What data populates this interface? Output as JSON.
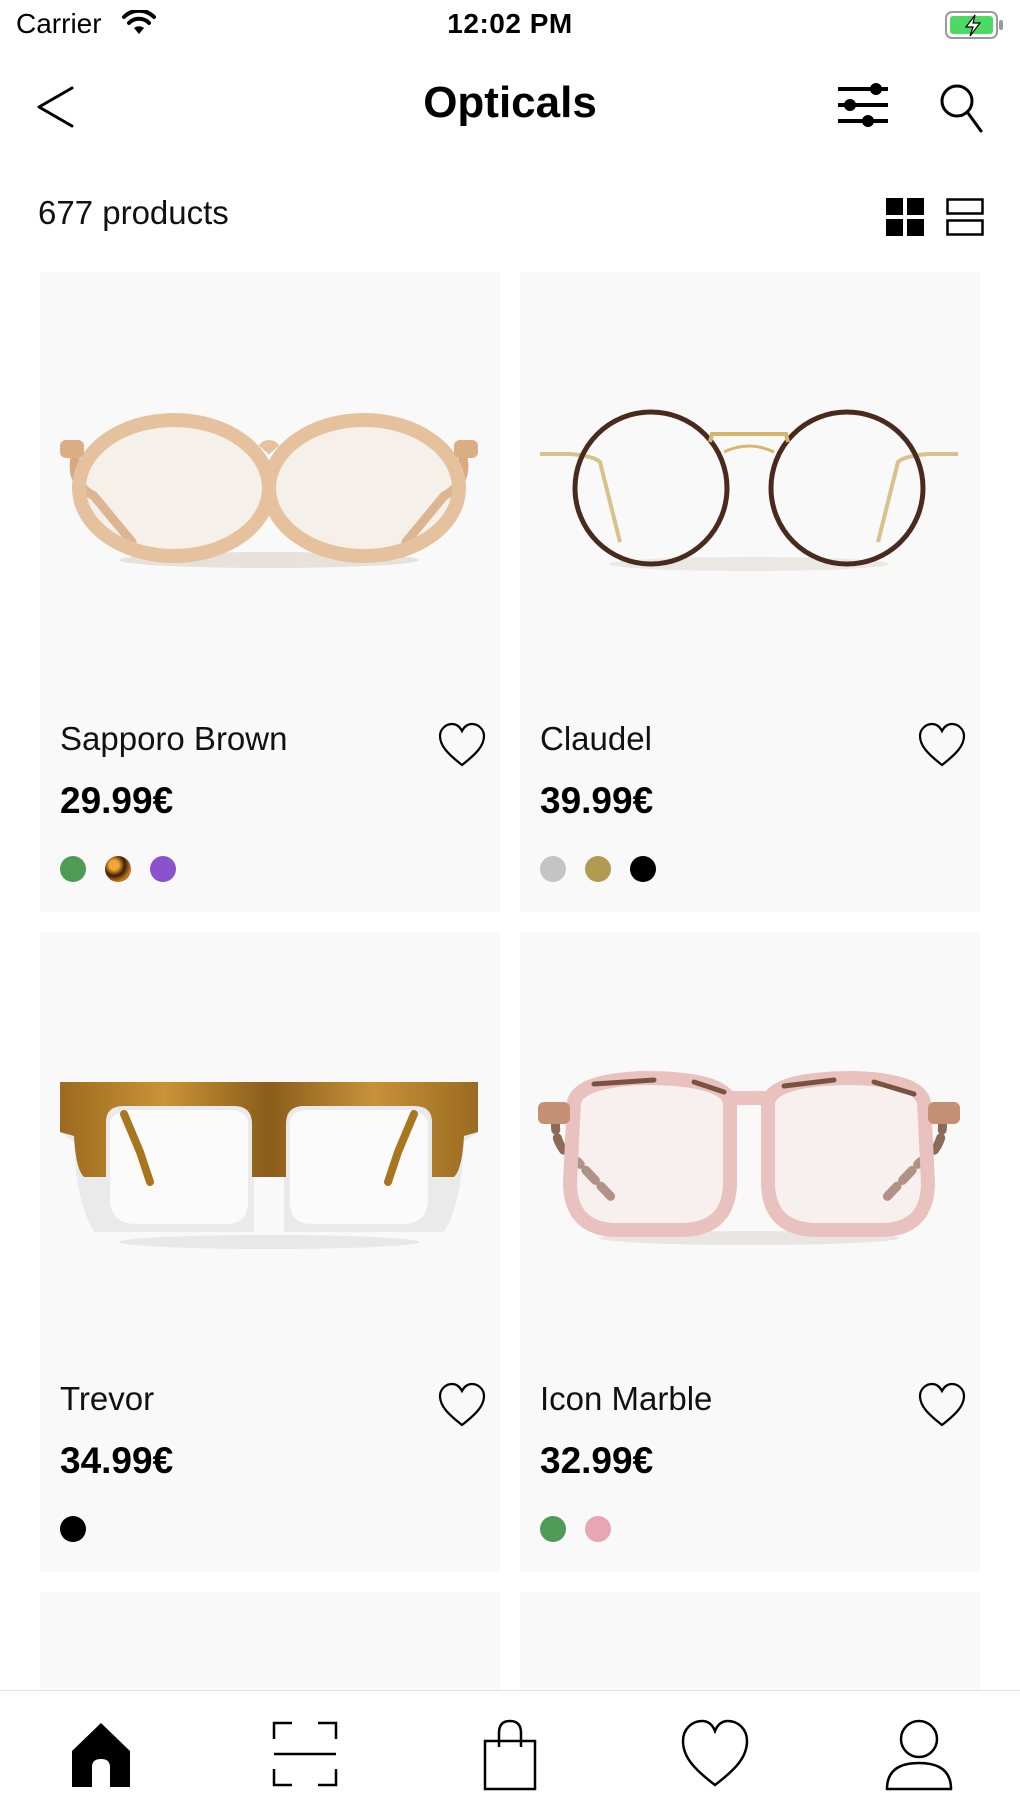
{
  "status_bar": {
    "carrier": "Carrier",
    "time": "12:02 PM",
    "battery_color": "#4cd964"
  },
  "header": {
    "title": "Opticals",
    "back_icon": "chevron-left-icon",
    "filter_icon": "sliders-icon",
    "search_icon": "search-icon"
  },
  "listing": {
    "count_label": "677 products",
    "views": [
      "grid-view-icon",
      "list-view-icon"
    ]
  },
  "products": [
    {
      "name": "Sapporo Brown",
      "price": "29.99€",
      "swatches": [
        "#4f9a55",
        "tortoise",
        "#8a52cc"
      ]
    },
    {
      "name": "Claudel",
      "price": "39.99€",
      "swatches": [
        "#c4c4c4",
        "#b19a52",
        "#000000"
      ]
    },
    {
      "name": "Trevor",
      "price": "34.99€",
      "swatches": [
        "#000000"
      ]
    },
    {
      "name": "Icon Marble",
      "price": "32.99€",
      "swatches": [
        "#4f9a55",
        "#e8a6b4"
      ]
    }
  ],
  "tab_bar": {
    "tabs": [
      "home-icon",
      "scan-icon",
      "bag-icon",
      "favorites-icon",
      "profile-icon"
    ],
    "active": "home-icon"
  }
}
